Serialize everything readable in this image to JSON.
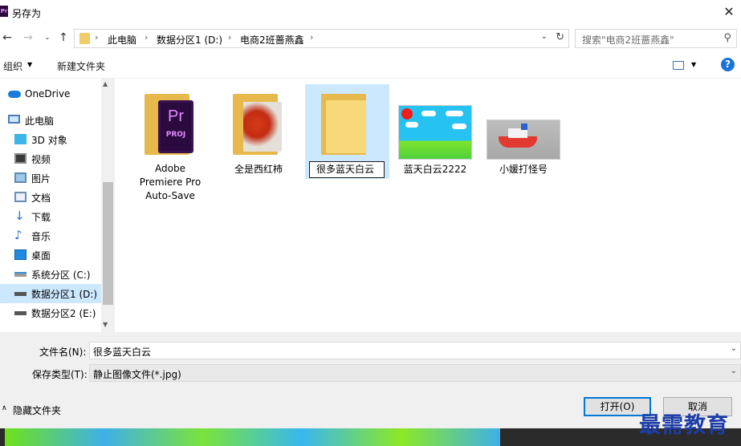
{
  "window": {
    "title": "另存为",
    "app_badge": "Pr"
  },
  "address": {
    "crumbs": [
      "此电脑",
      "数据分区1 (D:)",
      "电商2班蔷燕鑫"
    ],
    "search_placeholder": "搜索\"电商2班蔷燕鑫\""
  },
  "toolbar": {
    "organize": "组织",
    "new_folder": "新建文件夹"
  },
  "sidebar": {
    "items": [
      {
        "label": "OneDrive",
        "icon": "cloud-icon"
      },
      {
        "label": "此电脑",
        "icon": "computer-icon"
      },
      {
        "label": "3D 对象",
        "icon": "cube-icon"
      },
      {
        "label": "视频",
        "icon": "video-icon"
      },
      {
        "label": "图片",
        "icon": "pictures-icon"
      },
      {
        "label": "文档",
        "icon": "document-icon"
      },
      {
        "label": "下载",
        "icon": "download-icon"
      },
      {
        "label": "音乐",
        "icon": "music-icon"
      },
      {
        "label": "桌面",
        "icon": "desktop-icon"
      },
      {
        "label": "系统分区 (C:)",
        "icon": "drive-icon"
      },
      {
        "label": "数据分区1 (D:)",
        "icon": "drive-icon",
        "selected": true
      },
      {
        "label": "数据分区2 (E:)",
        "icon": "drive-icon"
      }
    ]
  },
  "files": [
    {
      "name": "Adobe\nPremiere Pro\nAuto-Save",
      "type": "folder-premiere",
      "badge_top": "Pr",
      "badge_bottom": "PROJ"
    },
    {
      "name": "全是西红柿",
      "type": "folder-tomato"
    },
    {
      "name": "很多蓝天白云",
      "type": "folder-renaming"
    },
    {
      "name": "蓝天白云2222",
      "type": "image-sky"
    },
    {
      "name": "小媛打怪号",
      "type": "image-boat"
    }
  ],
  "form": {
    "filename_label": "文件名(N):",
    "filename_value": "很多蓝天白云",
    "filetype_label": "保存类型(T):",
    "filetype_value": "静止图像文件(*.jpg)",
    "hide_folders": "隐藏文件夹",
    "open_button": "打开(O)",
    "cancel_button": "取消"
  },
  "watermark": "最需教育",
  "colors": {
    "accent": "#0078d7",
    "selection": "#cce8ff",
    "folder": "#f7d97a"
  }
}
